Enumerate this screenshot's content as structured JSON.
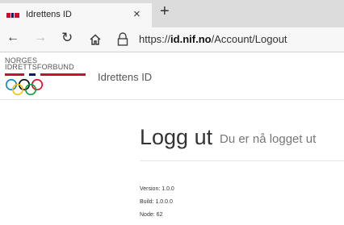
{
  "browser": {
    "tab_title": "Idrettens ID",
    "tab_close": "×",
    "new_tab": "+",
    "url_prefix": "https://",
    "url_host": "id.nif.no",
    "url_path": "/Account/Logout"
  },
  "header": {
    "logo_line1": "NORGES",
    "logo_line2": "IDRETTSFORBUND",
    "site_title": "Idrettens ID"
  },
  "main": {
    "title": "Logg ut",
    "subtitle": "Du er nå logget ut"
  },
  "info": {
    "version": "Version: 1.0.0",
    "build": "Build: 1.0.0.0",
    "node": "Node: 62"
  },
  "colors": {
    "norway_red": "#c8102e",
    "norway_blue": "#00205b"
  },
  "icons": [
    "back-arrow-icon",
    "forward-arrow-icon",
    "reload-icon",
    "home-icon",
    "lock-icon",
    "close-icon",
    "plus-icon",
    "olympic-rings-icon"
  ]
}
